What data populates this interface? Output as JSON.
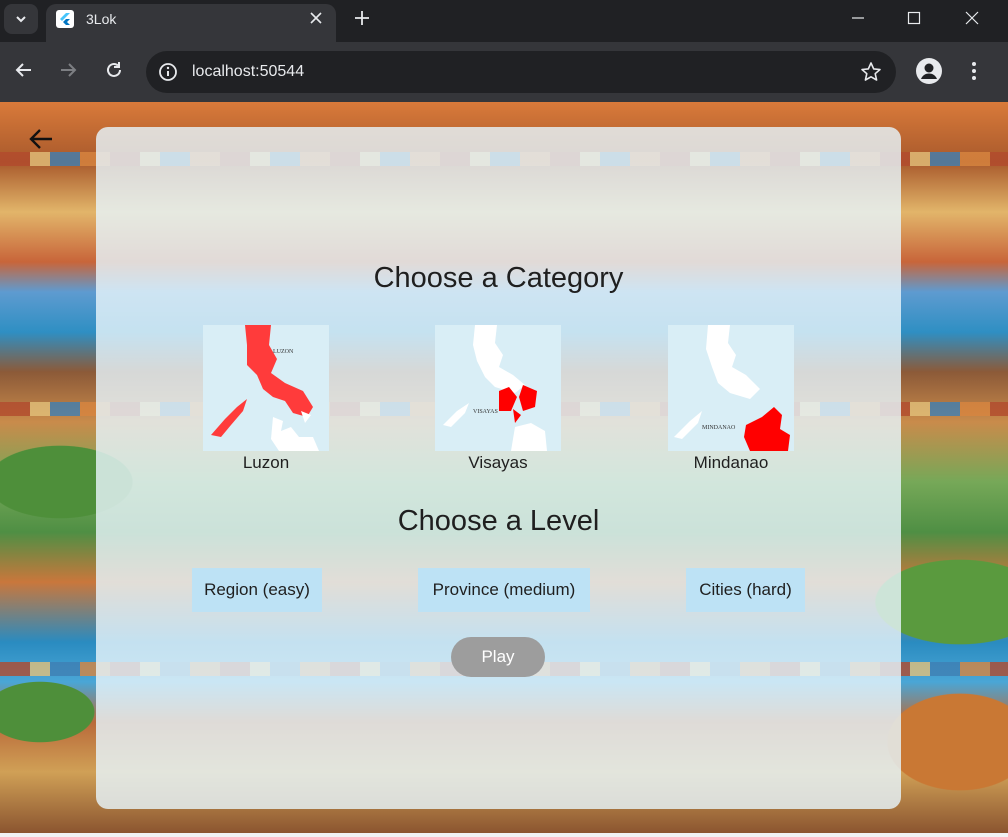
{
  "browser": {
    "tab_title": "3Lok",
    "url": "localhost:50544"
  },
  "page": {
    "category_heading": "Choose a Category",
    "categories": [
      {
        "label": "Luzon",
        "map_text": "LUZON"
      },
      {
        "label": "Visayas",
        "map_text": "VISAYAS"
      },
      {
        "label": "Mindanao",
        "map_text": "MINDANAO"
      }
    ],
    "level_heading": "Choose a Level",
    "levels": [
      {
        "label": "Region (easy)"
      },
      {
        "label": "Province (medium)"
      },
      {
        "label": "Cities (hard)"
      }
    ],
    "play_label": "Play"
  },
  "colors": {
    "highlight_red": "#ff0000",
    "level_button_bg": "#bde2f5",
    "play_button_bg": "#9d9d9d",
    "panel_bg": "#e7f4fa"
  },
  "icons": [
    "tab-search-icon",
    "flutter-logo-icon",
    "close-icon",
    "plus-icon",
    "minimize-icon",
    "maximize-icon",
    "window-close-icon",
    "back-arrow-icon",
    "forward-arrow-icon",
    "reload-icon",
    "site-info-icon",
    "bookmark-star-icon",
    "profile-icon",
    "menu-dots-icon",
    "arrow-left-icon"
  ]
}
